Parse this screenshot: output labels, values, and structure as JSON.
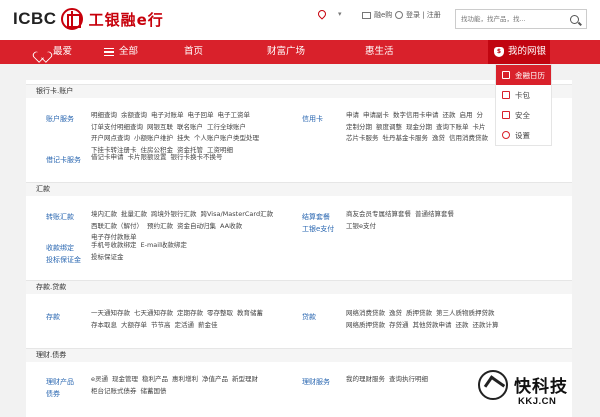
{
  "header": {
    "logo_en": "ICBC",
    "logo_cn": "工银融e行",
    "location_caret": "▾",
    "messages": "融e购",
    "login": "登录 | 注册",
    "search_placeholder": "找功能，找产品，找..."
  },
  "nav": {
    "favorites": "最爱",
    "all": "全部",
    "home": "首页",
    "wealth": "财富广场",
    "life": "惠生活",
    "mybank": "我的网银"
  },
  "dropdown": {
    "items": [
      "金融日历",
      "卡包",
      "安全",
      "设置"
    ]
  },
  "sections": [
    {
      "title": "银行卡.账户",
      "groups": [
        {
          "cat": "账户服务",
          "lines": [
            [
              "明细查询",
              "余额查询",
              "电子对账单",
              "电子回单",
              "电子工资单"
            ],
            [
              "订单支付明细查询",
              "网银互联",
              "联名账户",
              "工行全球账户"
            ],
            [
              "开户网点查询",
              "小额账户维护",
              "挂失",
              "个人账户账户类型处理"
            ],
            [
              "下挂卡转注册卡",
              "住房公积金",
              "资金托管",
              "工资明细"
            ]
          ]
        },
        {
          "cat": "借记卡服务",
          "lines": [
            [
              "借记卡申请",
              "卡片限额设置",
              "银行卡换卡不换号"
            ]
          ]
        },
        {
          "cat": "信用卡",
          "lines": [
            [
              "申请",
              "申请副卡",
              "数字信用卡申请",
              "还款",
              "启用",
              "分"
            ],
            [
              "定制分期",
              "额度调整",
              "现金分期",
              "查询下账单",
              "卡片"
            ],
            [
              "芯片卡服务",
              "牡丹基金卡服务",
              "逸贷",
              "信用消费贷款"
            ]
          ]
        }
      ]
    },
    {
      "title": "汇款",
      "groups": [
        {
          "cat": "转账汇款",
          "lines": [
            [
              "境内汇款",
              "批量汇款",
              "跨境外银行汇款",
              "跨Visa/MasterCard汇款"
            ],
            [
              "西联汇款（解付）",
              "预约汇款",
              "资金自动归集",
              "AA收款"
            ],
            [
              "电子存付款账单"
            ]
          ]
        },
        {
          "cat": "收款绑定",
          "lines": [
            [
              "手机号收款绑定",
              "E-mail收款绑定"
            ]
          ]
        },
        {
          "cat": "投标保证金",
          "lines": [
            [
              "投标保证金"
            ]
          ]
        },
        {
          "cat": "结算套餐",
          "lines": [
            [
              "商友会员专属结算套餐",
              "普通结算套餐"
            ]
          ]
        },
        {
          "cat": "工银e支付",
          "lines": [
            [
              "工银e支付"
            ]
          ]
        }
      ]
    },
    {
      "title": "存款.贷款",
      "groups": [
        {
          "cat": "存款",
          "lines": [
            [
              "一天通知存款",
              "七天通知存款",
              "定期存款",
              "零存整取",
              "教育储蓄"
            ],
            [
              "存本取息",
              "大额存单",
              "节节高",
              "定活通",
              "薪金佳"
            ]
          ]
        },
        {
          "cat": "贷款",
          "lines": [
            [
              "网络消费贷款",
              "逸贷",
              "质押贷款",
              "第三人质物质押贷款"
            ],
            [
              "网络质押贷款",
              "存贷通",
              "其他贷款申请",
              "还款",
              "还款计算"
            ]
          ]
        }
      ]
    },
    {
      "title": "理财.债券",
      "groups": [
        {
          "cat": "理财产品",
          "lines": [
            [
              "e灵通",
              "现金管理",
              "稳利产品",
              "惠利增利",
              "净值产品",
              "新型理财"
            ]
          ]
        },
        {
          "cat": "债券",
          "lines": [
            [
              "柜台记账式债券",
              "储蓄国债"
            ]
          ]
        },
        {
          "cat": "理财服务",
          "lines": [
            [
              "我的理财服务",
              "查询执行明细"
            ]
          ]
        }
      ]
    }
  ],
  "watermark": {
    "cn": "快科技",
    "en": "KKJ.CN"
  }
}
